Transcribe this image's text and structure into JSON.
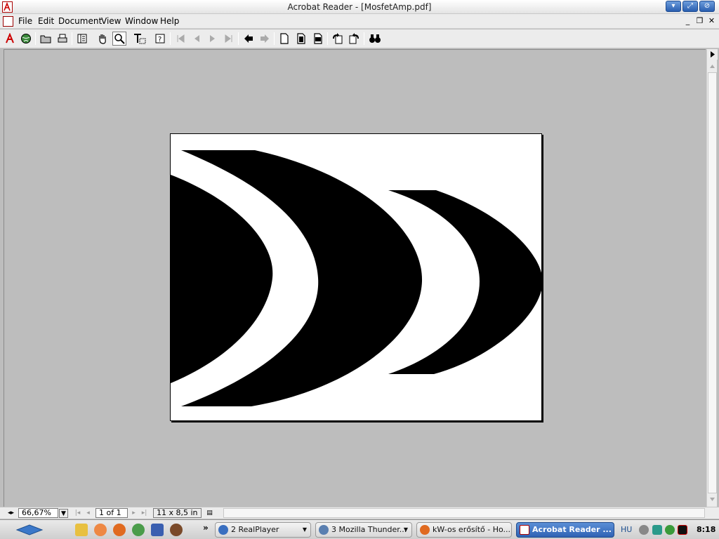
{
  "window": {
    "title": "Acrobat Reader - [MosfetAmp.pdf]",
    "controls": [
      "minimize-icon",
      "maximize-icon",
      "close-icon"
    ]
  },
  "menu": {
    "items": [
      "File",
      "Edit",
      "Document",
      "View",
      "Window",
      "Help"
    ],
    "doc_controls": [
      "_",
      "❐",
      "✕"
    ]
  },
  "toolbar": {
    "icons": [
      "acrobat-logo-icon",
      "globe-icon",
      "open-folder-icon",
      "print-icon",
      "show-hide-navigation-icon",
      "hand-tool-icon",
      "zoom-tool-icon",
      "text-select-icon",
      "help-icon",
      "first-page-icon",
      "previous-page-icon",
      "next-page-icon",
      "last-page-icon",
      "go-back-icon",
      "go-forward-icon",
      "actual-size-icon",
      "fit-page-icon",
      "fit-width-icon",
      "rotate-left-icon",
      "rotate-right-icon",
      "find-icon"
    ]
  },
  "statusbar": {
    "zoom": "66,67%",
    "page": "1 of 1",
    "page_size": "11 x 8,5 in"
  },
  "taskbar": {
    "tasks": [
      {
        "label": "2 RealPlayer",
        "active": false
      },
      {
        "label": "3 Mozilla Thunder...",
        "active": false
      },
      {
        "label": "kW-os erősítő - Ho...",
        "active": false
      },
      {
        "label": "Acrobat Reader ...",
        "active": true
      }
    ],
    "overflow": "»",
    "lang": "HU",
    "clock": "8:18"
  },
  "colors": {
    "doc_bg": "#bdbdbd",
    "active_task": "#2f62b4"
  }
}
